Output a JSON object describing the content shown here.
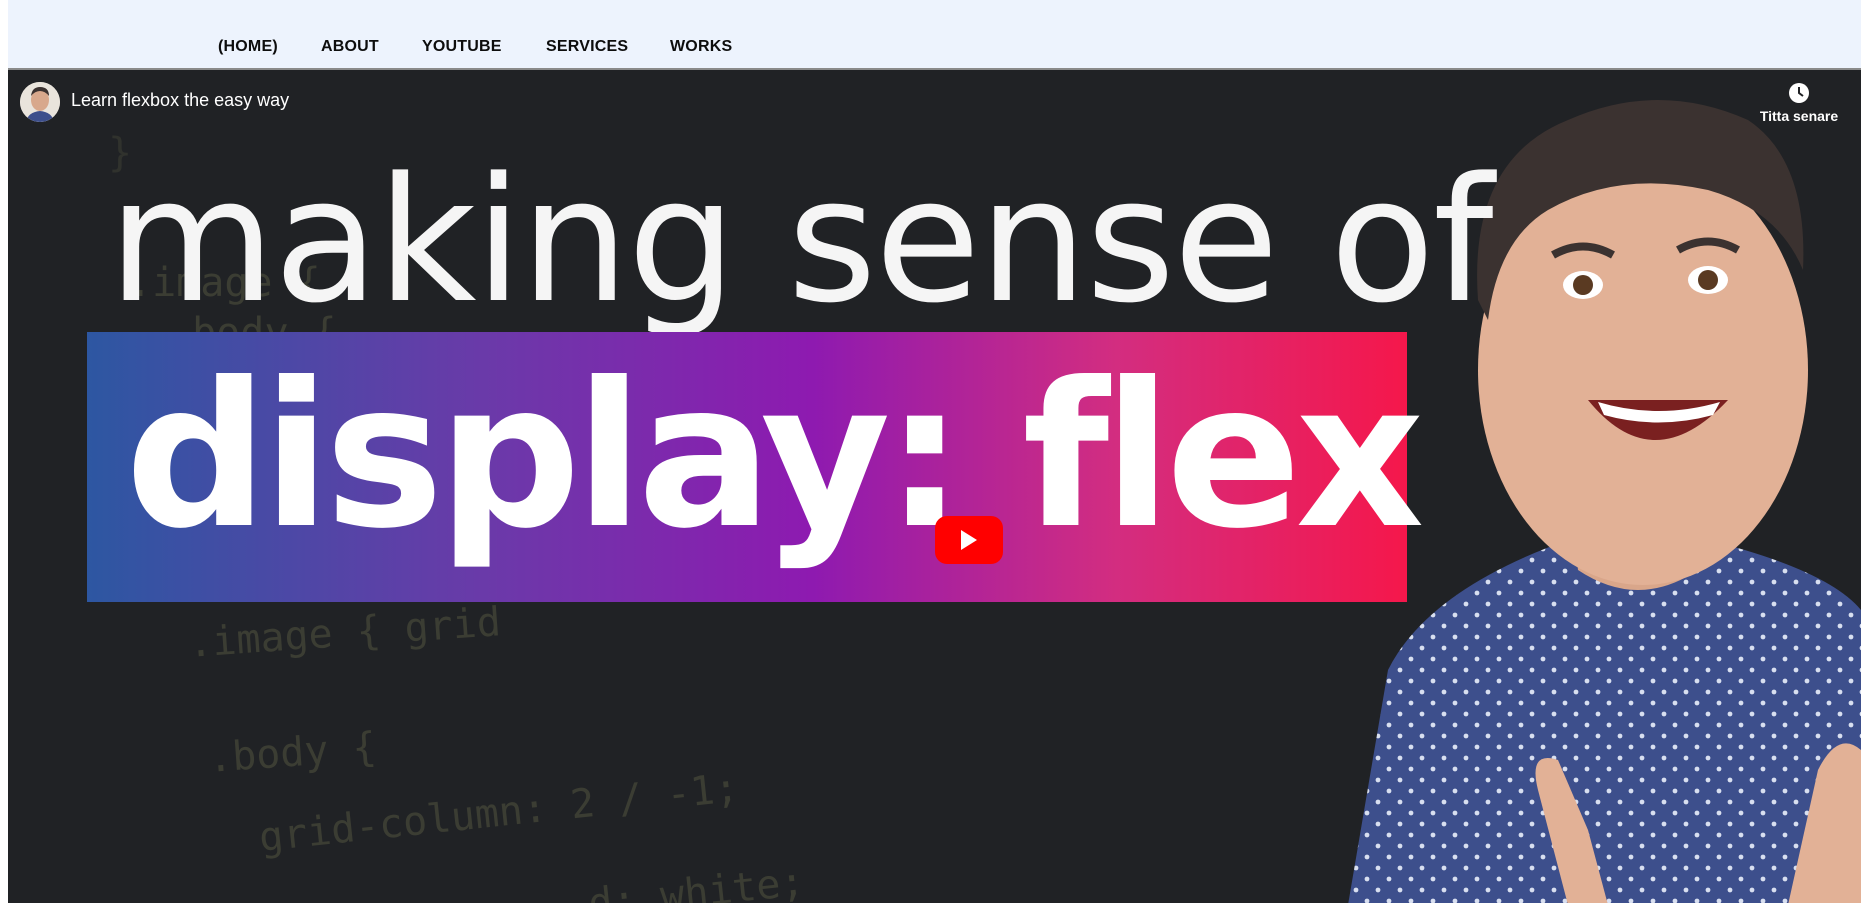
{
  "nav": {
    "items": [
      "(HOME)",
      "ABOUT",
      "YOUTUBE",
      "SERVICES",
      "WORKS"
    ]
  },
  "video": {
    "title": "Learn flexbox the easy way",
    "watch_later_label": "Titta senare",
    "thumbnail": {
      "headline": "making sense of",
      "banner_text": "display: flex",
      "code_snippets": [
        ".image {",
        ".body {",
        ".image { grid",
        ".body {",
        "grid-column: 2 / -1;",
        "d: white;",
        "}"
      ]
    },
    "icons": {
      "avatar": "channel-avatar",
      "watch_later": "clock-icon",
      "play": "youtube-play-icon"
    }
  },
  "colors": {
    "nav_bg": "#edf3fd",
    "player_bg": "#202225",
    "banner_start": "#2d57a2",
    "banner_mid": "#8e1ab0",
    "banner_end": "#f5174b",
    "play_button": "#ff0000"
  }
}
